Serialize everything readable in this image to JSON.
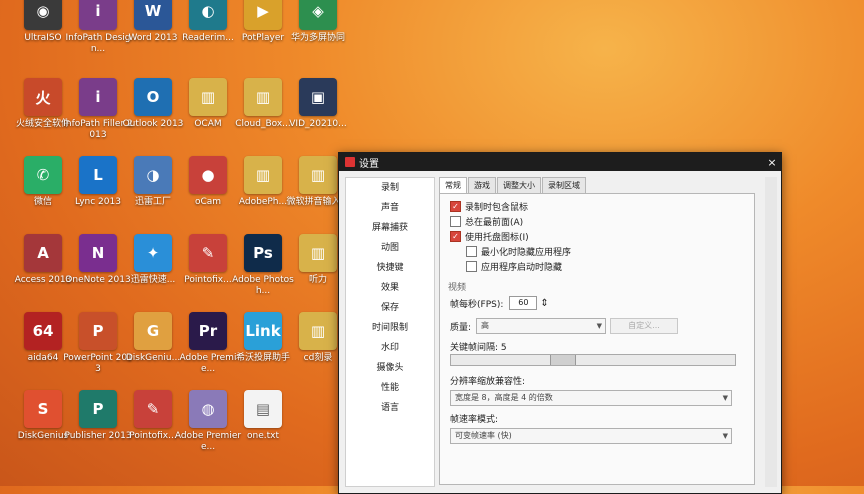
{
  "desktop": {
    "icons": [
      {
        "label": "UltraISO",
        "glyph": "◉",
        "color": "#3a3a3a"
      },
      {
        "label": "InfoPath Design...",
        "glyph": "i",
        "color": "#7a3d8a"
      },
      {
        "label": "Word 2013",
        "glyph": "W",
        "color": "#2b5797"
      },
      {
        "label": "Readerim...",
        "glyph": "◐",
        "color": "#1f7a8c"
      },
      {
        "label": "PotPlayer",
        "glyph": "▶",
        "color": "#d9a12b"
      },
      {
        "label": "华为多屏协同",
        "glyph": "◈",
        "color": "#2d8f4f"
      },
      {
        "label": "火绒安全软件",
        "glyph": "火",
        "color": "#c84a2a"
      },
      {
        "label": "InfoPath Filler 2013",
        "glyph": "i",
        "color": "#7a3d8a"
      },
      {
        "label": "Outlook 2013",
        "glyph": "O",
        "color": "#1f6fb2"
      },
      {
        "label": "OCAM",
        "glyph": "▥",
        "color": "#d8b24a"
      },
      {
        "label": "Cloud_Box...",
        "glyph": "▥",
        "color": "#d8b24a"
      },
      {
        "label": "VID_20210...",
        "glyph": "▣",
        "color": "#2a3a5a"
      },
      {
        "label": "微信",
        "glyph": "✆",
        "color": "#2aae67"
      },
      {
        "label": "Lync 2013",
        "glyph": "L",
        "color": "#1a73c8"
      },
      {
        "label": "迅雷工厂",
        "glyph": "◑",
        "color": "#4a7ab8"
      },
      {
        "label": "oCam",
        "glyph": "●",
        "color": "#c8413a"
      },
      {
        "label": "AdobePh...",
        "glyph": "▥",
        "color": "#d8b24a"
      },
      {
        "label": "微软拼音输入法",
        "glyph": "▥",
        "color": "#d8b24a"
      },
      {
        "label": "Access 2013",
        "glyph": "A",
        "color": "#a4373a"
      },
      {
        "label": "OneNote 2013",
        "glyph": "N",
        "color": "#7a2e8f"
      },
      {
        "label": "迅雷快速...",
        "glyph": "✦",
        "color": "#2a8fd8"
      },
      {
        "label": "Pointofix...",
        "glyph": "✎",
        "color": "#c8413a"
      },
      {
        "label": "Adobe Photosh...",
        "glyph": "Ps",
        "color": "#0f2b4a"
      },
      {
        "label": "听力",
        "glyph": "▥",
        "color": "#d8b24a"
      },
      {
        "label": "aida64",
        "glyph": "64",
        "color": "#b32222"
      },
      {
        "label": "PowerPoint 2013",
        "glyph": "P",
        "color": "#c8502a"
      },
      {
        "label": "DiskGeniu...",
        "glyph": "G",
        "color": "#e0a040"
      },
      {
        "label": "Adobe Premie...",
        "glyph": "Pr",
        "color": "#2a1a4a"
      },
      {
        "label": "希沃投屏助手",
        "glyph": "Link",
        "color": "#2aa0d8"
      },
      {
        "label": "cd刻录",
        "glyph": "▥",
        "color": "#d8b24a"
      },
      {
        "label": "DiskGenius",
        "glyph": "S",
        "color": "#e05030"
      },
      {
        "label": "Publisher 2013",
        "glyph": "P",
        "color": "#1f7a6a"
      },
      {
        "label": "Pointofix...",
        "glyph": "✎",
        "color": "#c8413a"
      },
      {
        "label": "Adobe Premiere...",
        "glyph": "◍",
        "color": "#8a7ab8"
      },
      {
        "label": "one.txt",
        "glyph": "▤",
        "color": "#f3f3f3"
      }
    ]
  },
  "dialog": {
    "title": "设置",
    "close": "×",
    "sidebar": [
      "录制",
      "声音",
      "屏幕捕获",
      "动图",
      "快捷键",
      "效果",
      "保存",
      "时间限制",
      "水印",
      "摄像头",
      "性能",
      "语言"
    ],
    "tabs": [
      "常规",
      "游戏",
      "调整大小",
      "录制区域"
    ],
    "options": {
      "include_cursor": "录制时包含鼠标",
      "always_on_top": "总在最前面(A)",
      "use_tray_icon": "使用托盘图标(I)",
      "hide_when_minimized": "最小化时隐藏应用程序",
      "hide_on_start": "应用程序启动时隐藏"
    },
    "video": {
      "group_title": "视频",
      "fps_label": "帧每秒(FPS):",
      "fps_value": "60",
      "quality_label": "质量:",
      "quality_value": "高",
      "custom_button": "自定义...",
      "keyframe_label": "关键帧间隔: 5",
      "keyframe_value": 0.38,
      "resolution_label": "分辨率缩放兼容性:",
      "resolution_value": "宽度是 8，高度是 4 的倍数",
      "rate_label": "帧速率模式:",
      "rate_value": "可变帧速率 (快)"
    }
  }
}
